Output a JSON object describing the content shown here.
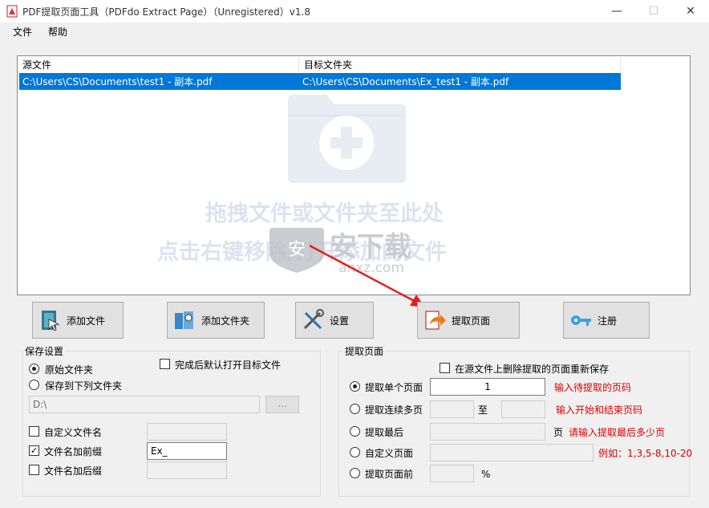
{
  "window": {
    "title": "PDF提取页面工具（PDFdo Extract Page）（Unregistered）v1.8",
    "min_glyph": "—",
    "max_glyph": "☐",
    "close_glyph": "✕"
  },
  "menu": {
    "file": "文件",
    "help": "帮助"
  },
  "file_list": {
    "columns": [
      "源文件",
      "目标文件夹"
    ],
    "rows": [
      {
        "source": "C:\\Users\\CS\\Documents\\test1 - 副本.pdf",
        "target": "C:\\Users\\CS\\Documents\\Ex_test1 - 副本.pdf"
      }
    ],
    "drop_hint_1": "拖拽文件或文件夹至此处",
    "drop_hint_2": "点击右键移除/打开添加的文件",
    "watermark_brand": "安下载",
    "watermark_domain": "anxz.com"
  },
  "toolbar": {
    "add_file": "添加文件",
    "add_folder": "添加文件夹",
    "settings": "设置",
    "extract": "提取页面",
    "register": "注册"
  },
  "save_settings": {
    "title": "保存设置",
    "original_folder": "原始文件夹",
    "save_to_folder": "保存到下列文件夹",
    "open_after": "完成后默认打开目标文件",
    "folder_path": "D:\\",
    "browse": "...",
    "custom_name": "自定义文件名",
    "custom_name_value": "",
    "add_prefix": "文件名加前缀",
    "prefix_value": "Ex_",
    "add_suffix": "文件名加后缀",
    "suffix_value": ""
  },
  "extract_settings": {
    "title": "提取页面",
    "delete_option": "在源文件上删除提取的页面重新保存",
    "single_page": "提取单个页面",
    "single_page_value": "1",
    "single_page_hint": "输入待提取的页码",
    "range": "提取连续多页",
    "range_to": "至",
    "range_hint": "输入开始和结束页码",
    "last": "提取最后",
    "last_unit": "页",
    "last_hint": "请输入提取最后多少页",
    "custom": "自定义页面",
    "custom_hint": "例如：1,3,5-8,10-20",
    "before": "提取页面前",
    "before_unit": "%"
  },
  "colors": {
    "selection": "#0078d7",
    "hint_red": "#e00000",
    "arrow": "#e02020"
  }
}
